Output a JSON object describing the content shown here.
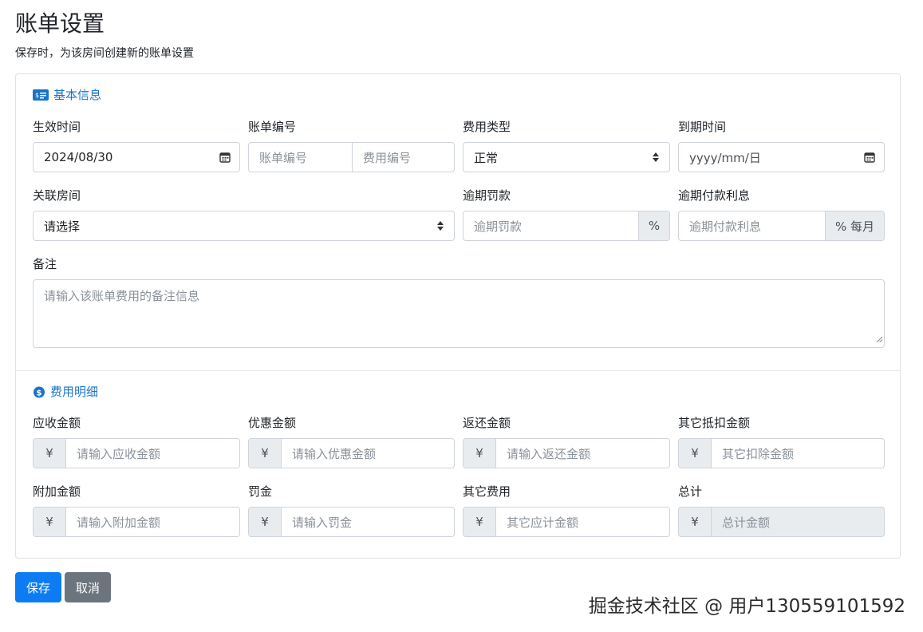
{
  "page": {
    "title": "账单设置",
    "subtitle": "保存时，为该房间创建新的账单设置"
  },
  "basic": {
    "section_title": "基本信息",
    "effective_date": {
      "label": "生效时间",
      "value": "2024/08/30"
    },
    "bill_number": {
      "label": "账单编号",
      "placeholder_1": "账单编号",
      "placeholder_2": "费用编号"
    },
    "fee_type": {
      "label": "费用类型",
      "value": "正常"
    },
    "due_date": {
      "label": "到期时间",
      "placeholder": "yyyy/mm/日"
    },
    "room": {
      "label": "关联房间",
      "value": "请选择"
    },
    "late_fee": {
      "label": "逾期罚款",
      "placeholder": "逾期罚款",
      "addon": "%"
    },
    "late_interest": {
      "label": "逾期付款利息",
      "placeholder": "逾期付款利息",
      "addon": "% 每月"
    },
    "remarks": {
      "label": "备注",
      "placeholder": "请输入该账单费用的备注信息"
    }
  },
  "fees": {
    "section_title": "费用明细",
    "currency": "¥",
    "receivable": {
      "label": "应收金额",
      "placeholder": "请输入应收金额"
    },
    "discount": {
      "label": "优惠金额",
      "placeholder": "请输入优惠金额"
    },
    "rebate": {
      "label": "返还金额",
      "placeholder": "请输入返还金额"
    },
    "other_deduction": {
      "label": "其它抵扣金额",
      "placeholder": "其它扣除金额"
    },
    "additional": {
      "label": "附加金额",
      "placeholder": "请输入附加金额"
    },
    "penalty": {
      "label": "罚金",
      "placeholder": "请输入罚金"
    },
    "other_fees": {
      "label": "其它费用",
      "placeholder": "其它应计金额"
    },
    "total": {
      "label": "总计",
      "placeholder": "总计金额"
    }
  },
  "actions": {
    "save": "保存",
    "cancel": "取消"
  },
  "watermark": "掘金技术社区 @ 用户130559101592",
  "colors": {
    "accent": "#1a73c8",
    "primary_button": "#0d7cf2",
    "secondary_button": "#6c757d",
    "addon_bg": "#e9ecef"
  }
}
